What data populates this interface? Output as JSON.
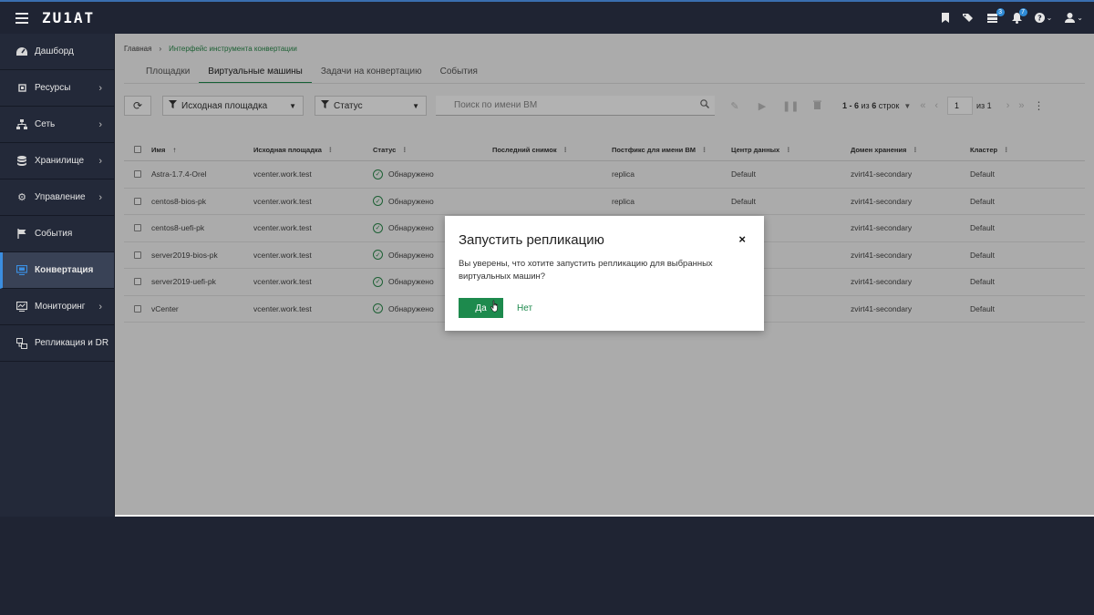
{
  "app": {
    "logo": "ZU1AT"
  },
  "topbar": {
    "icons": [
      "bookmark-icon",
      "tags-icon",
      "inbox-icon",
      "bell-icon",
      "help-icon",
      "user-icon"
    ],
    "inbox_badge": "3",
    "bell_badge": "7"
  },
  "sidebar": {
    "items": [
      {
        "label": "Дашборд",
        "icon": "dashboard-icon",
        "chevron": false
      },
      {
        "label": "Ресурсы",
        "icon": "chip-icon",
        "chevron": true
      },
      {
        "label": "Сеть",
        "icon": "network-icon",
        "chevron": true
      },
      {
        "label": "Хранилище",
        "icon": "database-icon",
        "chevron": true
      },
      {
        "label": "Управление",
        "icon": "gear-icon",
        "chevron": true
      },
      {
        "label": "События",
        "icon": "flag-icon",
        "chevron": false
      },
      {
        "label": "Конвертация",
        "icon": "monitor-icon",
        "chevron": false,
        "active": true
      },
      {
        "label": "Мониторинг",
        "icon": "chart-icon",
        "chevron": true
      },
      {
        "label": "Репликация и DR",
        "icon": "replication-icon",
        "chevron": false
      }
    ]
  },
  "breadcrumb": {
    "home": "Главная",
    "separator": "›",
    "current": "Интерфейс инструмента конвертации"
  },
  "tabs": [
    {
      "label": "Площадки"
    },
    {
      "label": "Виртуальные машины",
      "active": true
    },
    {
      "label": "Задачи на конвертацию"
    },
    {
      "label": "События"
    }
  ],
  "toolbar": {
    "filter_source": "Исходная площадка",
    "filter_status": "Статус",
    "search_placeholder": "Поиск по имени ВМ",
    "pager_range": "1 - 6",
    "pager_of": "из",
    "pager_total": "6",
    "pager_rows": "строк",
    "page_value": "1",
    "page_of_label": "из 1"
  },
  "table": {
    "headers": {
      "name": "Имя",
      "source": "Исходная площадка",
      "status": "Статус",
      "snapshot": "Последний снимок",
      "postfix": "Постфикс для имени ВМ",
      "datacenter": "Центр данных",
      "domain": "Домен хранения",
      "cluster": "Кластер"
    },
    "rows": [
      {
        "name": "Astra-1.7.4-Orel",
        "source": "vcenter.work.test",
        "status": "Обнаружено",
        "snapshot": "",
        "postfix": "replica",
        "datacenter": "Default",
        "domain": "zvirt41-secondary",
        "cluster": "Default"
      },
      {
        "name": "centos8-bios-pk",
        "source": "vcenter.work.test",
        "status": "Обнаружено",
        "snapshot": "",
        "postfix": "replica",
        "datacenter": "Default",
        "domain": "zvirt41-secondary",
        "cluster": "Default"
      },
      {
        "name": "centos8-uefi-pk",
        "source": "vcenter.work.test",
        "status": "Обнаружено",
        "snapshot": "",
        "postfix": "",
        "datacenter": "",
        "domain": "zvirt41-secondary",
        "cluster": "Default"
      },
      {
        "name": "server2019-bios-pk",
        "source": "vcenter.work.test",
        "status": "Обнаружено",
        "snapshot": "",
        "postfix": "",
        "datacenter": "",
        "domain": "zvirt41-secondary",
        "cluster": "Default"
      },
      {
        "name": "server2019-uefi-pk",
        "source": "vcenter.work.test",
        "status": "Обнаружено",
        "snapshot": "",
        "postfix": "",
        "datacenter": "",
        "domain": "zvirt41-secondary",
        "cluster": "Default"
      },
      {
        "name": "vCenter",
        "source": "vcenter.work.test",
        "status": "Обнаружено",
        "snapshot": "",
        "postfix": "",
        "datacenter": "",
        "domain": "zvirt41-secondary",
        "cluster": "Default"
      }
    ]
  },
  "modal": {
    "title": "Запустить репликацию",
    "body": "Вы уверены, что хотите запустить репликацию для выбранных виртуальных машин?",
    "yes_label": "Да",
    "no_label": "Нет",
    "close": "×"
  },
  "colors": {
    "accent": "#1d8a4d",
    "sidebar_bg": "#232939",
    "active_blue": "#3b8ee0"
  }
}
